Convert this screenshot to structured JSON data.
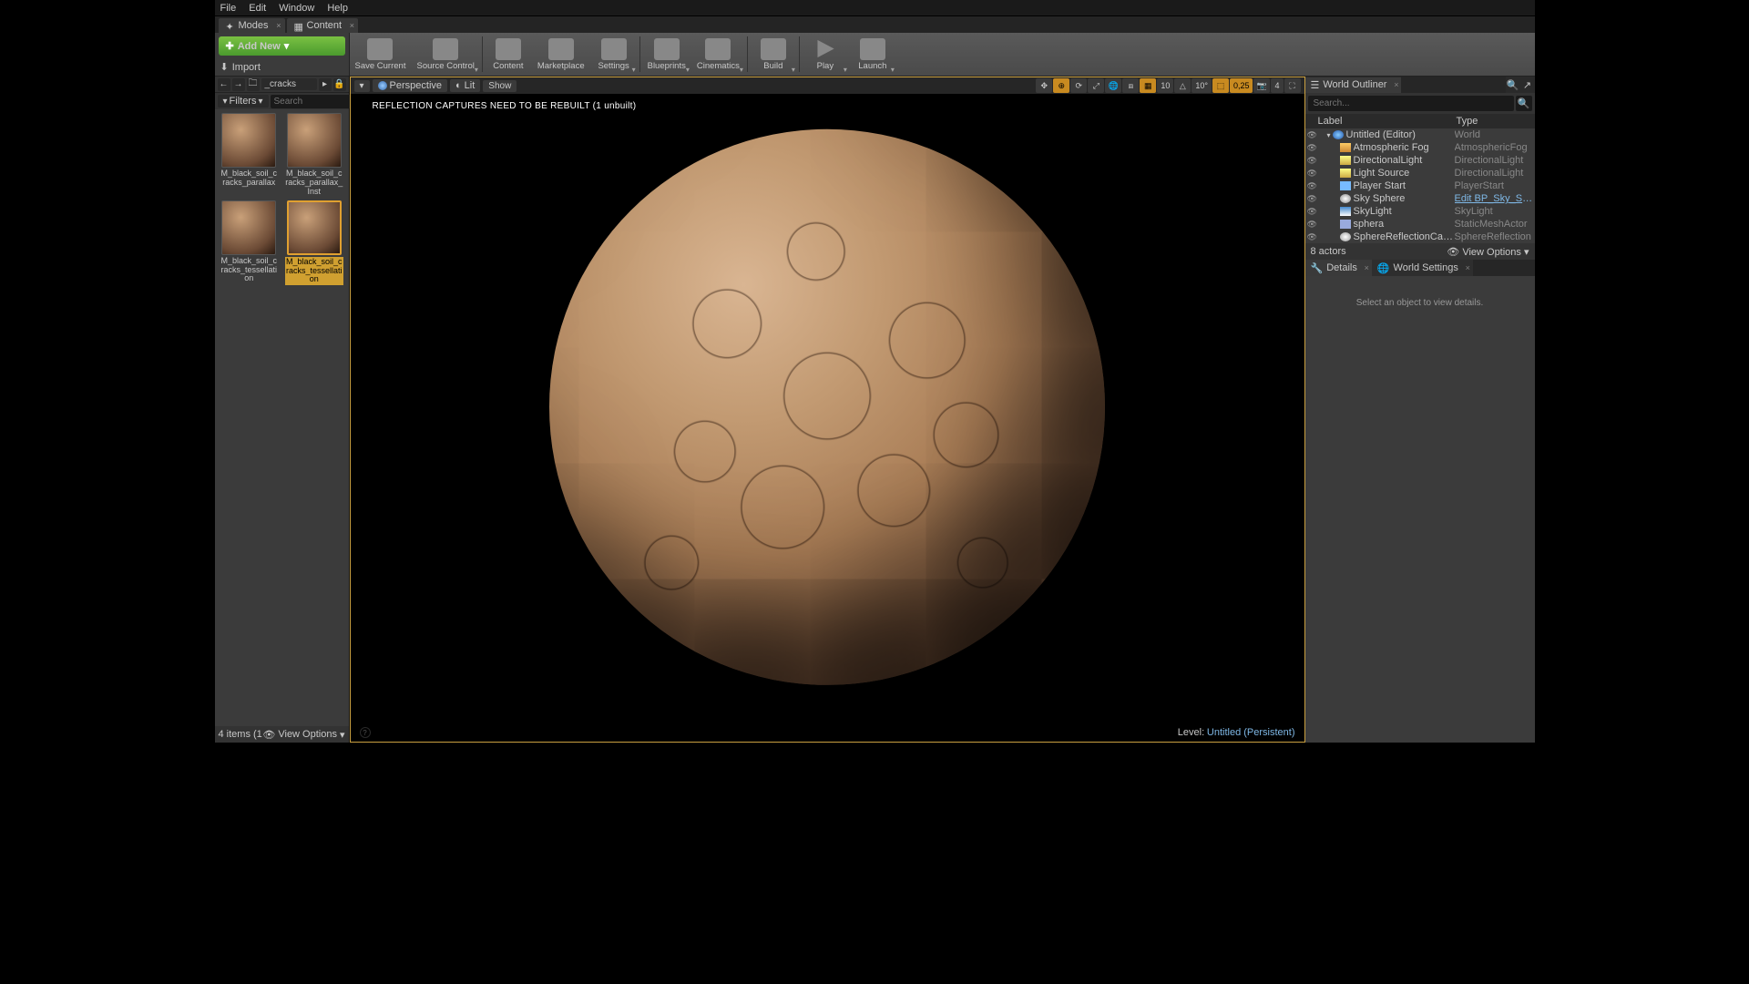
{
  "menubar": [
    "File",
    "Edit",
    "Window",
    "Help"
  ],
  "tabs": {
    "modes": "Modes",
    "content": "Content"
  },
  "toolbar": {
    "addnew": "Add New",
    "import": "Import",
    "buttons": [
      {
        "label": "Save Current",
        "icon": "i-save",
        "dd": false
      },
      {
        "label": "Source Control",
        "icon": "i-src",
        "dd": true
      },
      {
        "sep": true
      },
      {
        "label": "Content",
        "icon": "i-content",
        "dd": false
      },
      {
        "label": "Marketplace",
        "icon": "i-market",
        "dd": false
      },
      {
        "label": "Settings",
        "icon": "i-settings",
        "dd": true
      },
      {
        "sep": true
      },
      {
        "label": "Blueprints",
        "icon": "i-bp",
        "dd": true
      },
      {
        "label": "Cinematics",
        "icon": "i-cine",
        "dd": true
      },
      {
        "sep": true
      },
      {
        "label": "Build",
        "icon": "i-build",
        "dd": true
      },
      {
        "sep": true
      },
      {
        "label": "Play",
        "icon": "i-play",
        "dd": true
      },
      {
        "label": "Launch",
        "icon": "i-launch",
        "dd": true
      }
    ]
  },
  "cb": {
    "path": "_cracks",
    "filters": "Filters",
    "search_ph": "Search",
    "assets": [
      {
        "label": "M_black_soil_cracks_parallax",
        "sel": false
      },
      {
        "label": "M_black_soil_cracks_parallax_Inst",
        "sel": false
      },
      {
        "label": "M_black_soil_cracks_tessellation",
        "sel": false
      },
      {
        "label": "M_black_soil_cracks_tessellation",
        "sel": true
      }
    ],
    "status": "4 items (1",
    "viewopt": "View Options"
  },
  "viewport": {
    "perspective": "Perspective",
    "lit": "Lit",
    "show": "Show",
    "warning": "REFLECTION CAPTURES NEED TO BE REBUILT (1 unbuilt)",
    "snap_t": "10",
    "snap_r": "10°",
    "snap_s": "0,25",
    "cam": "4",
    "level_label": "Level:",
    "level_name": "Untitled (Persistent)"
  },
  "outliner": {
    "title": "World Outliner",
    "search_ph": "Search...",
    "col_label": "Label",
    "col_type": "Type",
    "rows": [
      {
        "indent": 0,
        "icon": "ic-globe",
        "name": "Untitled (Editor)",
        "type": "World",
        "link": false,
        "expand": true
      },
      {
        "indent": 1,
        "icon": "ic-fog",
        "name": "Atmospheric Fog",
        "type": "AtmosphericFog",
        "link": false
      },
      {
        "indent": 1,
        "icon": "ic-light",
        "name": "DirectionalLight",
        "type": "DirectionalLight",
        "link": false
      },
      {
        "indent": 1,
        "icon": "ic-light",
        "name": "Light Source",
        "type": "DirectionalLight",
        "link": false
      },
      {
        "indent": 1,
        "icon": "ic-player",
        "name": "Player Start",
        "type": "PlayerStart",
        "link": false
      },
      {
        "indent": 1,
        "icon": "ic-sphere",
        "name": "Sky Sphere",
        "type": "Edit BP_Sky_Sphere",
        "link": true
      },
      {
        "indent": 1,
        "icon": "ic-sky",
        "name": "SkyLight",
        "type": "SkyLight",
        "link": false
      },
      {
        "indent": 1,
        "icon": "ic-mesh",
        "name": "sphera",
        "type": "StaticMeshActor",
        "link": false
      },
      {
        "indent": 1,
        "icon": "ic-refl",
        "name": "SphereReflectionCapture",
        "type": "SphereReflection",
        "link": false
      }
    ],
    "count": "8 actors",
    "viewopt": "View Options"
  },
  "details": {
    "tab_details": "Details",
    "tab_world": "World Settings",
    "empty": "Select an object to view details."
  }
}
